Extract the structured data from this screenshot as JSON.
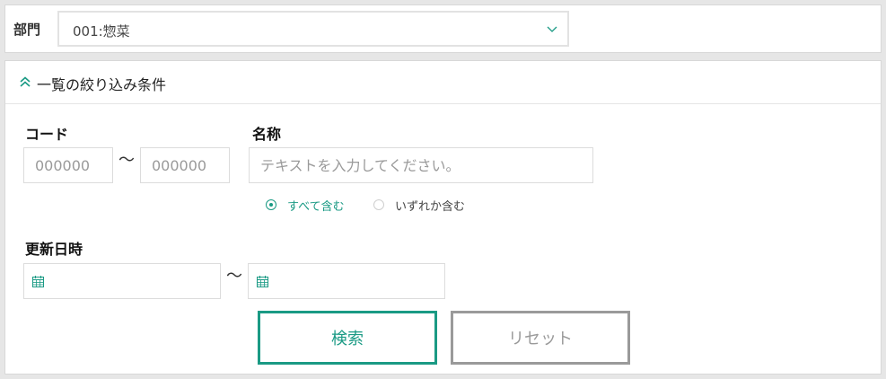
{
  "department": {
    "label": "部門",
    "selected": "001:惣菜"
  },
  "filter": {
    "title": "一覧の絞り込み条件",
    "code": {
      "label": "コード",
      "from_placeholder": "000000",
      "to_placeholder": "000000",
      "range_separator": "〜"
    },
    "name": {
      "label": "名称",
      "placeholder": "テキストを入力してください。",
      "match_options": [
        {
          "label": "すべて含む",
          "checked": true
        },
        {
          "label": "いずれか含む",
          "checked": false
        }
      ]
    },
    "updated": {
      "label": "更新日時",
      "range_separator": "〜"
    }
  },
  "buttons": {
    "search": "検索",
    "reset": "リセット"
  },
  "colors": {
    "accent": "#1a9a84",
    "muted": "#9a9a9a"
  }
}
